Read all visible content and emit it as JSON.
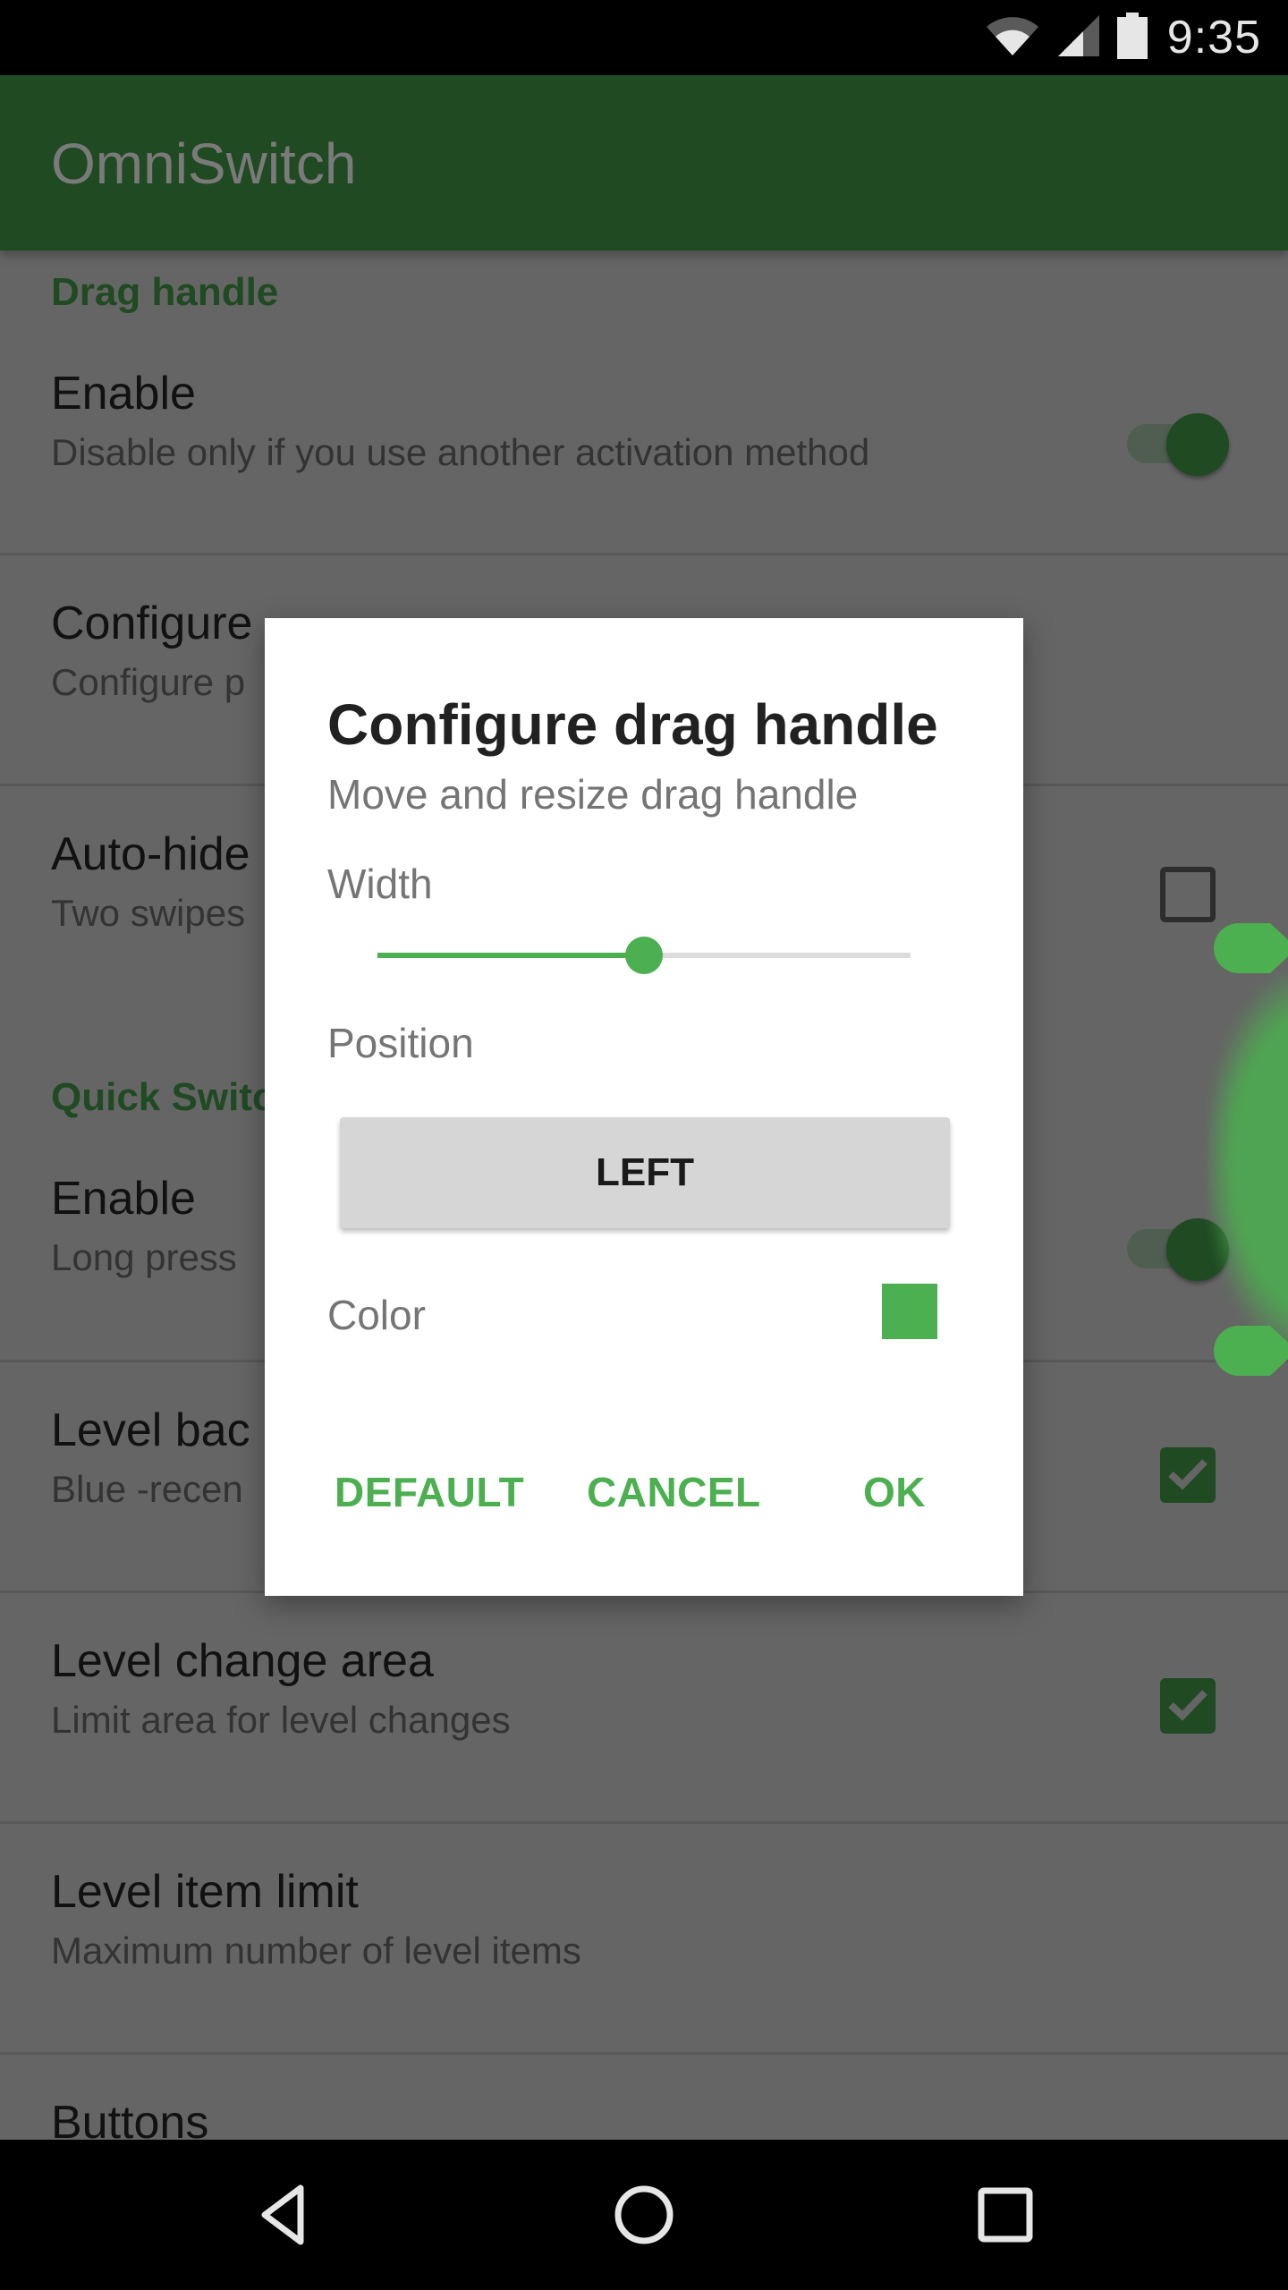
{
  "status_bar": {
    "time": "9:35",
    "icons": [
      "wifi-icon",
      "cell-signal-icon",
      "battery-icon"
    ]
  },
  "app_bar": {
    "title": "OmniSwitch"
  },
  "settings": {
    "sections": [
      {
        "header": "Drag handle",
        "items": [
          {
            "title": "Enable",
            "subtitle": "Disable only if you use another activation method",
            "control": "switch",
            "checked": true
          },
          {
            "title": "Configure",
            "subtitle": "Configure p",
            "control": "none"
          },
          {
            "title": "Auto-hide",
            "subtitle": "Two swipes",
            "control": "checkbox",
            "checked": false
          }
        ]
      },
      {
        "header": "Quick Switc",
        "items": [
          {
            "title": "Enable",
            "subtitle": "Long press",
            "control": "switch",
            "checked": true
          },
          {
            "title": "Level bac",
            "subtitle": "Blue -recen",
            "control": "checkbox",
            "checked": true
          },
          {
            "title": "Level change area",
            "subtitle": "Limit area for level changes",
            "control": "checkbox",
            "checked": true
          },
          {
            "title": "Level item limit",
            "subtitle": "Maximum number of level items",
            "control": "none"
          },
          {
            "title": "Buttons",
            "subtitle": "",
            "control": "none"
          }
        ]
      }
    ]
  },
  "dialog": {
    "title": "Configure drag handle",
    "subtitle": "Move and resize drag handle",
    "width_label": "Width",
    "width_value": 0.5,
    "position_label": "Position",
    "position_value": "LEFT",
    "color_label": "Color",
    "color_value": "#4caf50",
    "actions": {
      "default": "DEFAULT",
      "cancel": "CANCEL",
      "ok": "OK"
    }
  },
  "colors": {
    "accent": "#4caf50",
    "primary_dimmed": "#1f4a22"
  },
  "nav_bar": {
    "buttons": [
      "back-icon",
      "home-icon",
      "recents-icon"
    ]
  }
}
